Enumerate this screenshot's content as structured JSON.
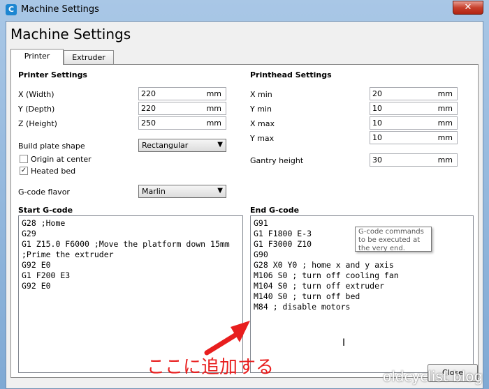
{
  "window": {
    "title": "Machine Settings",
    "app_icon": "C",
    "close_glyph": "✕"
  },
  "dialog": {
    "title": "Machine Settings"
  },
  "tabs": [
    {
      "label": "Printer",
      "active": true
    },
    {
      "label": "Extruder",
      "active": false
    }
  ],
  "printer_settings": {
    "title": "Printer Settings",
    "width": {
      "label": "X (Width)",
      "value": "220",
      "unit": "mm"
    },
    "depth": {
      "label": "Y (Depth)",
      "value": "220",
      "unit": "mm"
    },
    "height": {
      "label": "Z (Height)",
      "value": "250",
      "unit": "mm"
    },
    "build_plate": {
      "label": "Build plate shape",
      "value": "Rectangular"
    },
    "origin_center": {
      "label": "Origin at center",
      "checked": false
    },
    "heated_bed": {
      "label": "Heated bed",
      "checked": true,
      "mark": "✓"
    },
    "gcode_flavor": {
      "label": "G-code flavor",
      "value": "Marlin"
    }
  },
  "printhead_settings": {
    "title": "Printhead Settings",
    "x_min": {
      "label": "X min",
      "value": "20",
      "unit": "mm"
    },
    "y_min": {
      "label": "Y min",
      "value": "10",
      "unit": "mm"
    },
    "x_max": {
      "label": "X max",
      "value": "10",
      "unit": "mm"
    },
    "y_max": {
      "label": "Y max",
      "value": "10",
      "unit": "mm"
    },
    "gantry_height": {
      "label": "Gantry height",
      "value": "30",
      "unit": "mm"
    }
  },
  "start_gcode": {
    "title": "Start G-code",
    "lines": [
      "G28 ;Home",
      "G29",
      "G1 Z15.0 F6000 ;Move the platform down 15mm",
      ";Prime the extruder",
      "G92 E0",
      "G1 F200 E3",
      "G92 E0"
    ]
  },
  "end_gcode": {
    "title": "End G-code",
    "lines": [
      "G91",
      "G1 F1800 E-3",
      "G1 F3000 Z10",
      "G90",
      "G28 X0 Y0 ; home x and y axis",
      "M106 S0 ; turn off cooling fan",
      "M104 S0 ; turn off extruder",
      "M140 S0 ; turn off bed",
      "M84 ; disable motors"
    ],
    "tooltip_lines": [
      "G-code commands",
      "to be executed at",
      "the very end."
    ]
  },
  "buttons": {
    "close": "Close"
  },
  "annotation": {
    "text": "ここに追加する",
    "color": "#e81e1e"
  },
  "watermark": "oldcyclist blog",
  "cursor_glyph": "I"
}
